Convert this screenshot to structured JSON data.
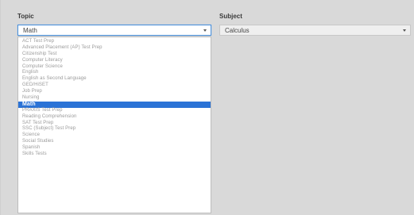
{
  "topic": {
    "label": "Topic",
    "selected": "Math",
    "options": [
      "ACT Test Prep",
      "Advanced Placement (AP) Test Prep",
      "Citizenship Test",
      "Computer Literacy",
      "Computer Science",
      "English",
      "English as Second Language",
      "GED/HiSET",
      "Job Prep",
      "Nursing",
      "Math",
      "PRAXIS Test Prep",
      "Reading Comprehension",
      "SAT Test Prep",
      "SSC (Subject) Test Prep",
      "Science",
      "Social Studies",
      "Spanish",
      "Skills Tests"
    ],
    "selected_index": 10
  },
  "subject": {
    "label": "Subject",
    "selected": "Calculus"
  },
  "icons": {
    "dropdown_arrow": "chevron-down-icon"
  }
}
